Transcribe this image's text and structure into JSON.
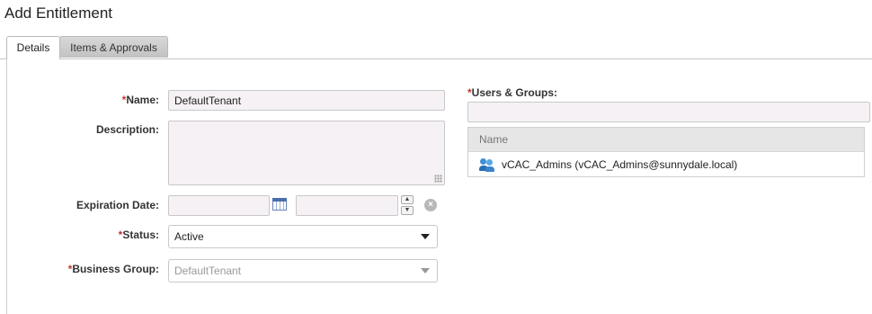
{
  "page": {
    "title": "Add Entitlement"
  },
  "tabs": [
    {
      "label": "Details",
      "active": true
    },
    {
      "label": "Items & Approvals",
      "active": false
    }
  ],
  "form": {
    "required_marker": "*",
    "name": {
      "label": "Name:",
      "value": "DefaultTenant"
    },
    "description": {
      "label": "Description:",
      "value": ""
    },
    "expiration_date": {
      "label": "Expiration Date:",
      "date_value": "",
      "time_value": ""
    },
    "status": {
      "label": "Status:",
      "value": "Active"
    },
    "business_group": {
      "label": "Business Group:",
      "value": "DefaultTenant"
    }
  },
  "users_groups": {
    "label": "Users & Groups:",
    "search_value": "",
    "column_header": "Name",
    "rows": [
      {
        "icon": "users-icon",
        "name": "vCAC_Admins (vCAC_Admins@sunnydale.local)"
      }
    ]
  },
  "icons": {
    "calendar": "calendar-icon",
    "spin_up": "▲",
    "spin_down": "▼",
    "clear": "×"
  },
  "colors": {
    "required": "#c0392b",
    "input_bg": "#f6f1f4",
    "grid_header_bg": "#e6e6e6"
  }
}
